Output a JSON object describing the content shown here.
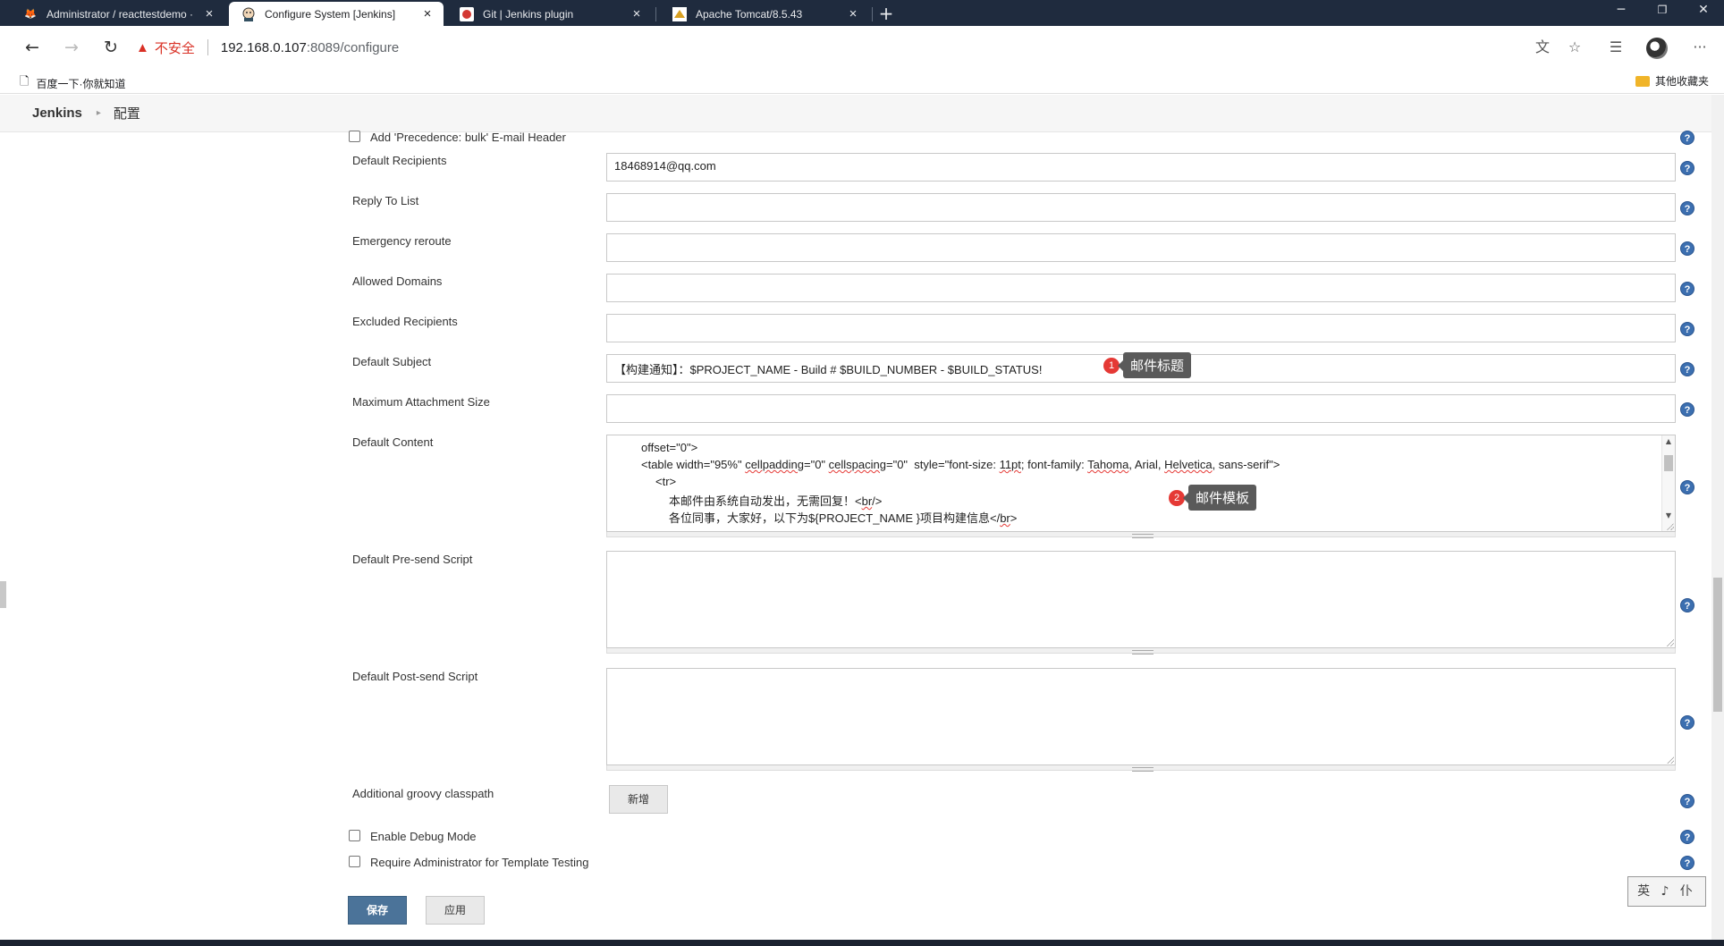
{
  "browser": {
    "tabs": [
      {
        "title": "Administrator / reacttestdemo · G",
        "icon": "gitlab-icon"
      },
      {
        "title": "Configure System [Jenkins]",
        "icon": "jenkins-icon"
      },
      {
        "title": "Git | Jenkins plugin",
        "icon": "jenkins-plugin-icon"
      },
      {
        "title": "Apache Tomcat/8.5.43",
        "icon": "tomcat-icon"
      }
    ],
    "address": {
      "insecure_label": "不安全",
      "host": "192.168.0.107",
      "path": ":8089/configure"
    },
    "bookmarks": {
      "left": "百度一下·你就知道",
      "right": "其他收藏夹"
    }
  },
  "jenkins": {
    "breadcrumb": {
      "root": "Jenkins",
      "current": "配置"
    }
  },
  "form": {
    "precedence_label": "Add 'Precedence: bulk' E-mail Header",
    "default_recipients_label": "Default Recipients",
    "default_recipients_value": "18468914@qq.com",
    "reply_to_label": "Reply To List",
    "emergency_label": "Emergency reroute",
    "allowed_domains_label": "Allowed Domains",
    "excluded_label": "Excluded Recipients",
    "subject_label": "Default Subject",
    "subject_value": "【构建通知】：$PROJECT_NAME - Build # $BUILD_NUMBER - $BUILD_STATUS!",
    "max_attach_label": "Maximum Attachment Size",
    "content_label": "Default Content",
    "content_lines": {
      "l1": "offset=\"0\">",
      "l2a": "<table width=\"95%\" ",
      "l2b": "cellpadding",
      "l2c": "=\"0\" ",
      "l2d": "cellspacing",
      "l2e": "=\"0\"  style=\"font-size: ",
      "l2f": "11pt",
      "l2g": "; font-family: ",
      "l2h": "Tahoma",
      "l2i": ", Arial, ",
      "l2j": "Helvetica",
      "l2k": ", sans-serif\">",
      "l3": "<tr>",
      "l4a": "本邮件由系统自动发出，无需回复！<",
      "l4b": "br",
      "l4c": "/>",
      "l5a": "各位同事，大家好，以下为${PROJECT_NAME }项目构建信息</",
      "l5b": "br",
      "l5c": ">"
    },
    "presend_label": "Default Pre-send Script",
    "postsend_label": "Default Post-send Script",
    "classpath_label": "Additional groovy classpath",
    "add_button": "新增",
    "debug_label": "Enable Debug Mode",
    "require_admin_label": "Require Administrator for Template Testing",
    "save_button": "保存",
    "apply_button": "应用"
  },
  "annotations": [
    {
      "num": "1",
      "text": "邮件标题"
    },
    {
      "num": "2",
      "text": "邮件模板"
    }
  ],
  "ime": "英 ♪ 仆"
}
